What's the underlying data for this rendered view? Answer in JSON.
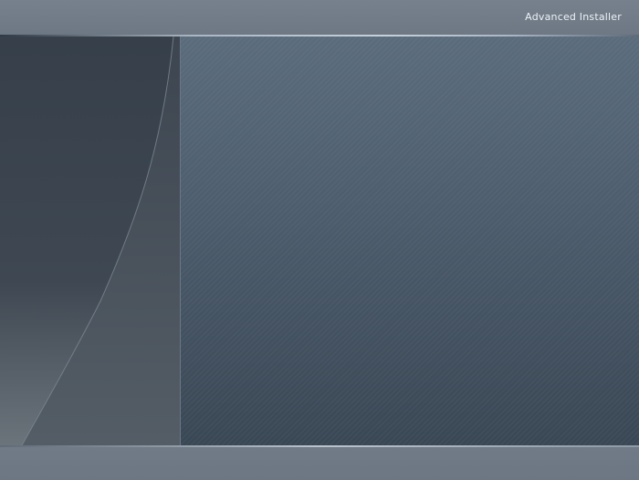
{
  "header": {
    "brand": "Advanced Installer"
  },
  "colors": {
    "frame": "#727d89",
    "side_panel": "#363f4a",
    "main_panel_top": "#5b6c7d",
    "main_panel_bottom": "#3a4755",
    "brand_text": "#eef2f6"
  }
}
